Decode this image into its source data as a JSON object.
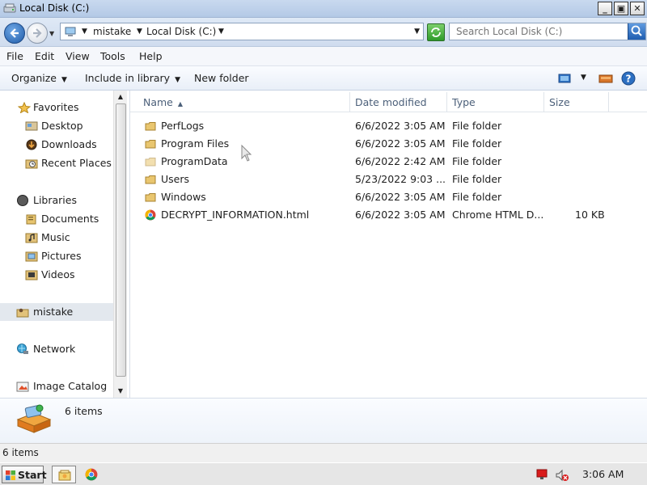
{
  "window": {
    "title": "Local Disk (C:)",
    "minimize_glyph": "_",
    "maximize_glyph": "▣",
    "close_glyph": "✕"
  },
  "address": {
    "crumbs": [
      "mistake",
      "Local Disk (C:)"
    ],
    "search_placeholder": "Search Local Disk (C:)"
  },
  "menu": [
    "File",
    "Edit",
    "View",
    "Tools",
    "Help"
  ],
  "commands": {
    "organize": "Organize",
    "include_in_library": "Include in library",
    "new_folder": "New folder"
  },
  "nav": {
    "favorites": "Favorites",
    "desktop": "Desktop",
    "downloads": "Downloads",
    "recent_places": "Recent Places",
    "libraries": "Libraries",
    "documents": "Documents",
    "music": "Music",
    "pictures": "Pictures",
    "videos": "Videos",
    "user": "mistake",
    "network": "Network",
    "image_catalog": "Image Catalog"
  },
  "columns": {
    "name": "Name",
    "date_modified": "Date modified",
    "type": "Type",
    "size": "Size"
  },
  "files": [
    {
      "name": "PerfLogs",
      "date": "6/6/2022 3:05 AM",
      "type": "File folder",
      "size": "",
      "icon": "folder-icon"
    },
    {
      "name": "Program Files",
      "date": "6/6/2022 3:05 AM",
      "type": "File folder",
      "size": "",
      "icon": "folder-icon"
    },
    {
      "name": "ProgramData",
      "date": "6/6/2022 2:42 AM",
      "type": "File folder",
      "size": "",
      "icon": "folder-icon"
    },
    {
      "name": "Users",
      "date": "5/23/2022 9:03 ...",
      "type": "File folder",
      "size": "",
      "icon": "folder-icon"
    },
    {
      "name": "Windows",
      "date": "6/6/2022 3:05 AM",
      "type": "File folder",
      "size": "",
      "icon": "folder-icon"
    },
    {
      "name": "DECRYPT_INFORMATION.html",
      "date": "6/6/2022 3:05 AM",
      "type": "Chrome HTML D...",
      "size": "10 KB",
      "icon": "chrome-icon"
    }
  ],
  "details": {
    "item_count": "6 items"
  },
  "status": {
    "item_count": "6 items"
  },
  "taskbar": {
    "start_label": "Start",
    "clock": "3:06 AM"
  },
  "colors": {
    "accent": "#1e5ba8",
    "selected_nav": "#e3e8ee",
    "header_text": "#4c607a"
  }
}
